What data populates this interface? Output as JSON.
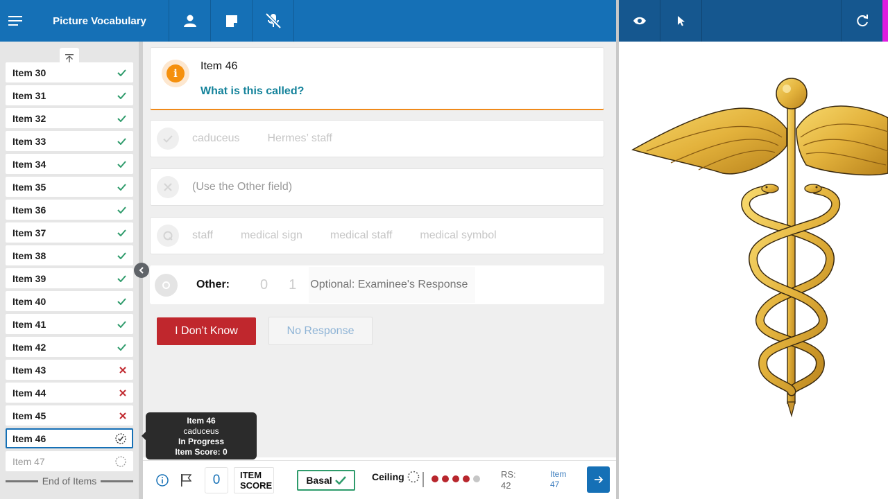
{
  "app": {
    "title": "Picture Vocabulary"
  },
  "sidebar": {
    "items": [
      {
        "label": "Item 30",
        "status": "correct"
      },
      {
        "label": "Item 31",
        "status": "correct"
      },
      {
        "label": "Item 32",
        "status": "correct"
      },
      {
        "label": "Item 33",
        "status": "correct"
      },
      {
        "label": "Item 34",
        "status": "correct"
      },
      {
        "label": "Item 35",
        "status": "correct"
      },
      {
        "label": "Item 36",
        "status": "correct"
      },
      {
        "label": "Item 37",
        "status": "correct"
      },
      {
        "label": "Item 38",
        "status": "correct"
      },
      {
        "label": "Item 39",
        "status": "correct"
      },
      {
        "label": "Item 40",
        "status": "correct"
      },
      {
        "label": "Item 41",
        "status": "correct"
      },
      {
        "label": "Item 42",
        "status": "correct"
      },
      {
        "label": "Item 43",
        "status": "incorrect"
      },
      {
        "label": "Item 44",
        "status": "incorrect"
      },
      {
        "label": "Item 45",
        "status": "incorrect"
      },
      {
        "label": "Item 46",
        "status": "in-progress"
      },
      {
        "label": "Item 47",
        "status": "pending"
      }
    ],
    "end_label": "End of Items"
  },
  "question": {
    "title": "Item 46",
    "prompt": "What is this called?"
  },
  "responses": {
    "correct_words": [
      "caduceus",
      "Hermes’ staff"
    ],
    "incorrect_words": [
      "(Use the Other field)"
    ],
    "query_words": [
      "staff",
      "medical sign",
      "medical staff",
      "medical symbol"
    ],
    "other": {
      "label": "Other:",
      "score_0": "0",
      "score_1": "1",
      "placeholder": "Optional: Examinee's Response"
    }
  },
  "buttons": {
    "dont_know": "I Don’t Know",
    "no_response": "No Response"
  },
  "tooltip": {
    "item": "Item 46",
    "word": "caduceus",
    "status": "In Progress",
    "score": "Item Score: 0"
  },
  "bottombar": {
    "item_score_value": "0",
    "item_score_line1": "ITEM",
    "item_score_line2": "SCORE",
    "basal_label": "Basal",
    "ceiling_label": "Ceiling",
    "ceiling_dots": [
      1,
      1,
      1,
      1,
      0
    ],
    "rs_label": "RS:",
    "rs_value": "42",
    "next_item_label": "Item",
    "next_item_num": "47"
  },
  "colors": {
    "primary": "#1570b6",
    "topbar_dark": "#15578f",
    "correct": "#2e9b6b",
    "incorrect": "#c0272d",
    "accent_orange": "#f5900d",
    "prompt_teal": "#13829a",
    "picture_gold": "#e3b23c"
  },
  "icons": {
    "menu": "hamburger-menu-icon",
    "person": "person-icon",
    "note": "note-icon",
    "mic_off": "microphone-off-icon",
    "eye": "eye-icon",
    "pointer": "pointer-icon",
    "refresh": "refresh-icon"
  },
  "picture": {
    "subject": "caduceus"
  }
}
